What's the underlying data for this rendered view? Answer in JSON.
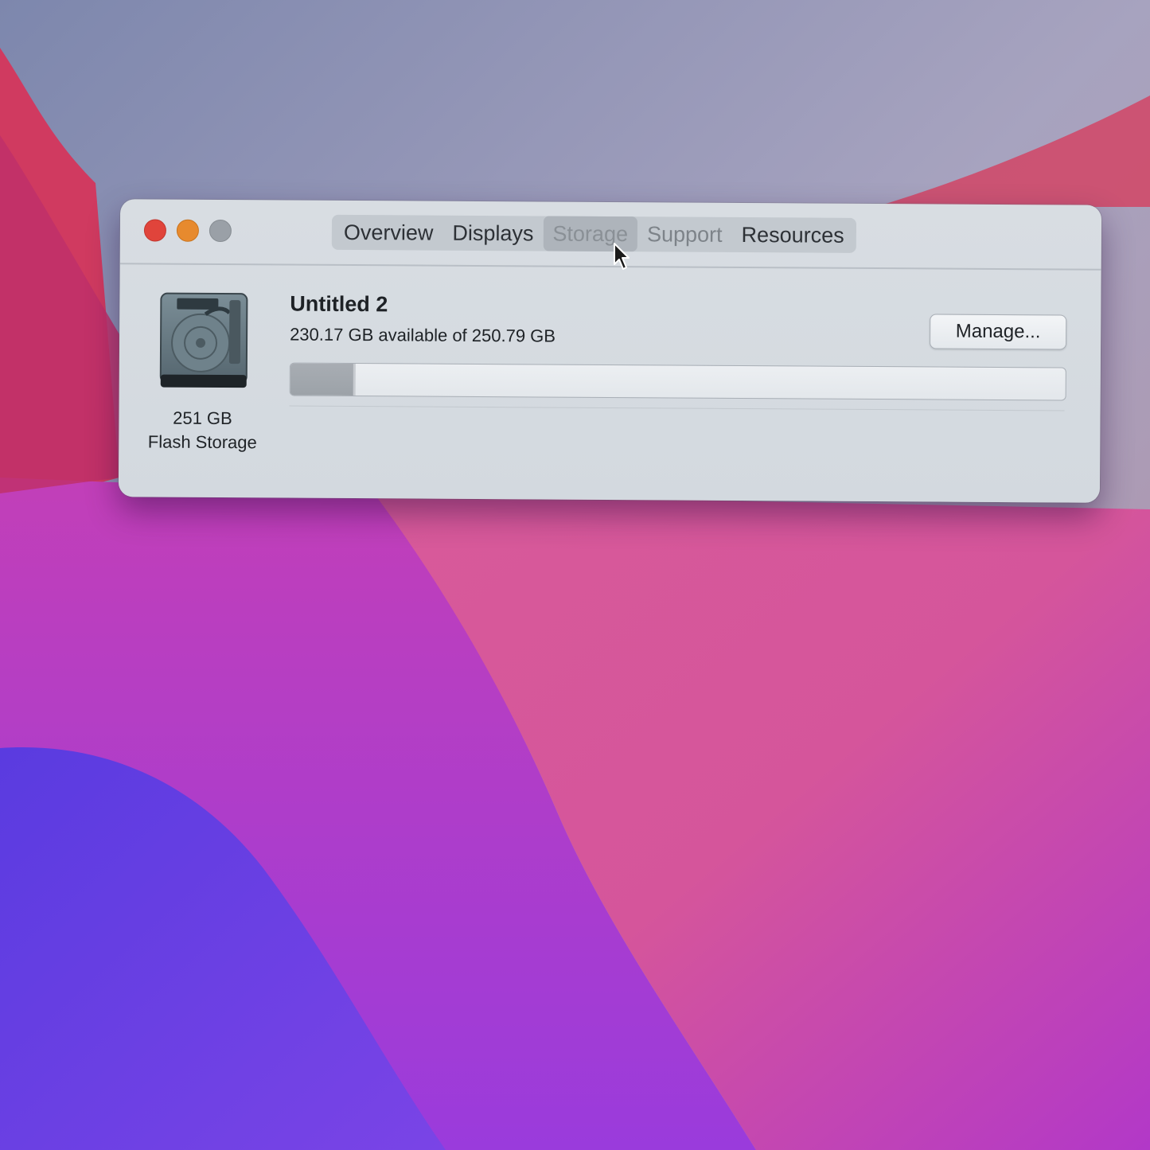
{
  "window": {
    "tabs": [
      {
        "label": "Overview"
      },
      {
        "label": "Displays"
      },
      {
        "label": "Storage"
      },
      {
        "label": "Support"
      },
      {
        "label": "Resources"
      }
    ],
    "active_tab": "Storage"
  },
  "disk": {
    "icon": "hard-drive-icon",
    "size": "251 GB",
    "type": "Flash Storage"
  },
  "volume": {
    "name": "Untitled 2",
    "available_text": "230.17 GB available of 250.79 GB",
    "used_fraction": 0.082
  },
  "buttons": {
    "manage_label": "Manage..."
  },
  "colors": {
    "close": "#e0443b",
    "minimize": "#e78a2e",
    "maximize": "#9aa0a7",
    "window_bg": "#d8dde2"
  }
}
